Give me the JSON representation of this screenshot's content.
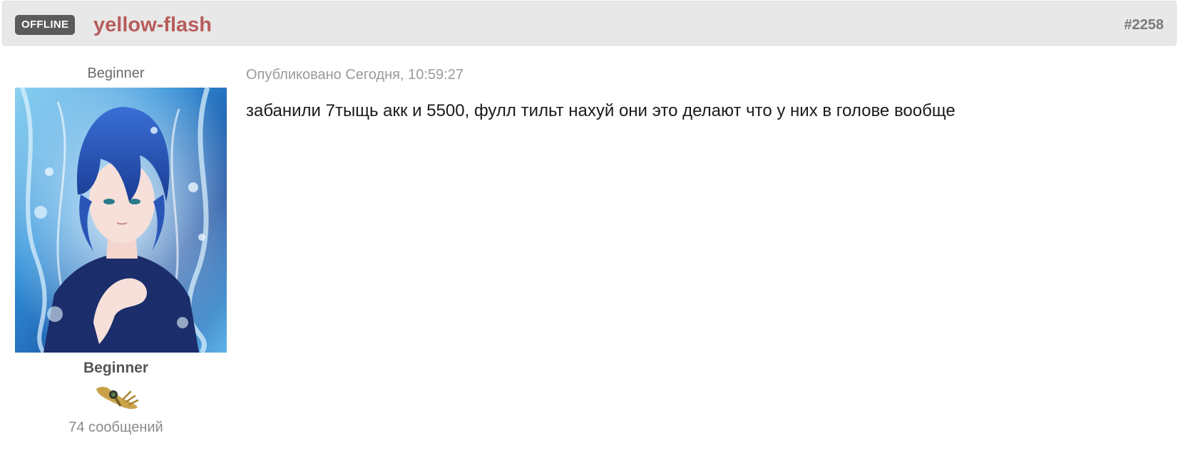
{
  "header": {
    "status": "OFFLINE",
    "author": "yellow-flash",
    "post_number": "#2258"
  },
  "author_panel": {
    "title_top": "Beginner",
    "rank": "Beginner",
    "post_count": "74 сообщений",
    "avatar_icon": "anime-avatar-image",
    "rank_icon": "rank-badge-icon"
  },
  "post": {
    "meta": "Опубликовано Сегодня, 10:59:27",
    "body": "забанили 7тыщь акк и 5500, фулл тильт нахуй они это делают что у них в голове вообще"
  },
  "colors": {
    "header_bg": "#e8e8e8",
    "badge_bg": "#5b5b5b",
    "author_name": "#b85c5c",
    "post_number": "#7a7a7a",
    "meta_text": "#9a9a9a"
  }
}
